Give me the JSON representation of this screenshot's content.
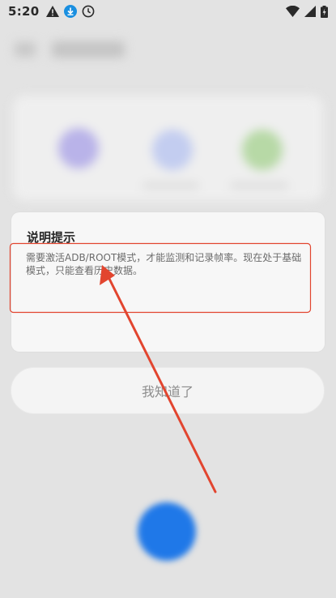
{
  "status_bar": {
    "time": "5:20",
    "left_icons": [
      "warning-icon",
      "download-icon",
      "clock-icon"
    ],
    "right_icons": [
      "wifi-icon",
      "signal-icon",
      "battery-icon"
    ]
  },
  "dialog": {
    "title": "说明提示",
    "message": "需要激活ADB/ROOT模式，才能监测和记录帧率。现在处于基础模式，只能查看历史数据。"
  },
  "confirm_button": {
    "label": "我知道了"
  },
  "colors": {
    "annotation_red": "#e2452f",
    "fab_blue": "#1f78e8",
    "background": "#e3e3e3"
  }
}
